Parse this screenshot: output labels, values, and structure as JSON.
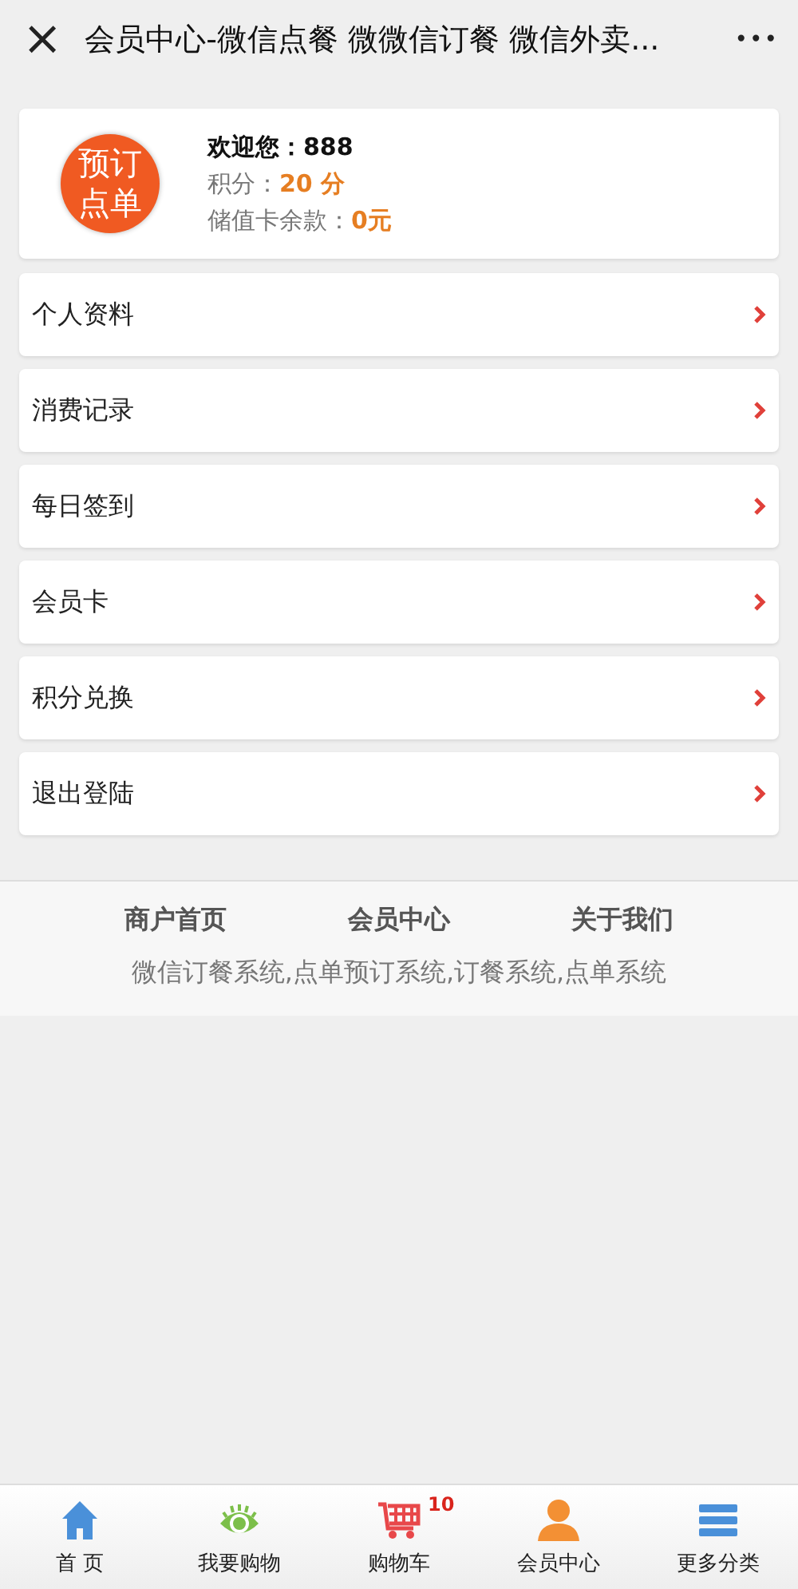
{
  "header": {
    "close": "×",
    "title": "会员中心-微信点餐 微微信订餐 微信外卖...",
    "more": "•••"
  },
  "profile": {
    "logo": [
      "预订",
      "点单"
    ],
    "welcome_label": "欢迎您：",
    "username": "888",
    "points_label": "积分：",
    "points": "20 分",
    "balance_label": "储值卡余款：",
    "balance": "0元"
  },
  "menu": [
    {
      "label": "个人资料"
    },
    {
      "label": "消费记录"
    },
    {
      "label": "每日签到"
    },
    {
      "label": "会员卡"
    },
    {
      "label": "积分兑换"
    },
    {
      "label": "退出登陆"
    }
  ],
  "footer": {
    "links": [
      "商户首页",
      "会员中心",
      "关于我们"
    ],
    "keywords": "微信订餐系统,点单预订系统,订餐系统,点单系统"
  },
  "tabbar": [
    {
      "kind": "home",
      "label": "首 页"
    },
    {
      "kind": "eye",
      "label": "我要购物"
    },
    {
      "kind": "cart",
      "label": "购物车",
      "badge": "10"
    },
    {
      "kind": "user",
      "label": "会员中心"
    },
    {
      "kind": "list",
      "label": "更多分类"
    }
  ]
}
